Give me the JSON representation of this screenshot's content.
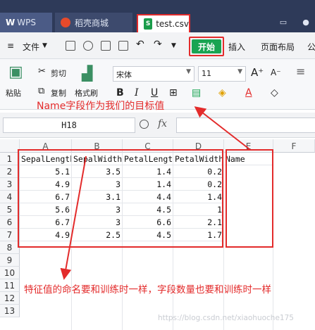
{
  "tabs": [
    {
      "label": "WPS"
    },
    {
      "label": "稻壳商城"
    },
    {
      "label": "test.csv"
    }
  ],
  "menu": {
    "file": "文件",
    "start": "开始",
    "insert": "插入",
    "page_layout": "页面布局",
    "formula_partial": "公"
  },
  "ribbon": {
    "paste": "粘贴",
    "cut": "剪切",
    "copy": "复制",
    "format_painter": "格式刷",
    "font_name": "宋体",
    "font_size": "11",
    "bold": "B",
    "italic": "I",
    "underline": "U",
    "font_color_letter": "A"
  },
  "annotations": {
    "target": "Name字段作为我们的目标值",
    "feature_note": "特征值的命名要和训练时一样，字段数量也要和训练时一样",
    "watermark": "https://blog.csdn.net/xiaohuoche175"
  },
  "formula_bar": {
    "cell_ref": "H18",
    "fx": "fx"
  },
  "grid": {
    "columns": [
      "A",
      "B",
      "C",
      "D",
      "E",
      "F"
    ],
    "rows": [
      "1",
      "2",
      "3",
      "4",
      "5",
      "6",
      "7",
      "8",
      "9",
      "10",
      "11",
      "12",
      "13"
    ],
    "header": [
      "SepalLength",
      "SepalWidth",
      "PetalLength",
      "PetalWidth",
      "Name"
    ],
    "data": [
      [
        "5.1",
        "3.5",
        "1.4",
        "0.2"
      ],
      [
        "4.9",
        "3",
        "1.4",
        "0.2"
      ],
      [
        "6.7",
        "3.1",
        "4.4",
        "1.4"
      ],
      [
        "5.6",
        "3",
        "4.5",
        "1"
      ],
      [
        "6.7",
        "3",
        "6.6",
        "2.1"
      ],
      [
        "4.9",
        "2.5",
        "4.5",
        "1.7"
      ]
    ]
  },
  "colors": {
    "tabbar": "#2e3a59",
    "start_button": "#19a452",
    "annotation_red": "#e32b2b"
  }
}
